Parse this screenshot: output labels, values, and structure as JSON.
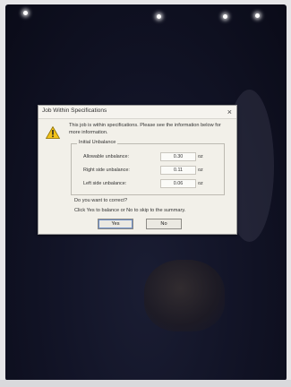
{
  "dialog": {
    "title": "Job Within Specifications",
    "close_glyph": "×",
    "icon": "warning-icon",
    "message": "This job is within specifications. Please see the information below for more information.",
    "group_title": "Initial Unbalance",
    "rows": [
      {
        "label": "Allowable unbalance:",
        "value": "0.30",
        "unit": "oz"
      },
      {
        "label": "Right side unbalance:",
        "value": "0.11",
        "unit": "oz"
      },
      {
        "label": "Left side unbalance:",
        "value": "0.06",
        "unit": "oz"
      }
    ],
    "question": "Do you want to correct?",
    "instruction": "Click Yes to balance or No to skip to the summary.",
    "buttons": {
      "yes": "Yes",
      "no": "No"
    }
  },
  "colors": {
    "screen_background": "#121427",
    "dialog_background": "#f2f0e9",
    "warning_yellow": "#f2c21a"
  }
}
